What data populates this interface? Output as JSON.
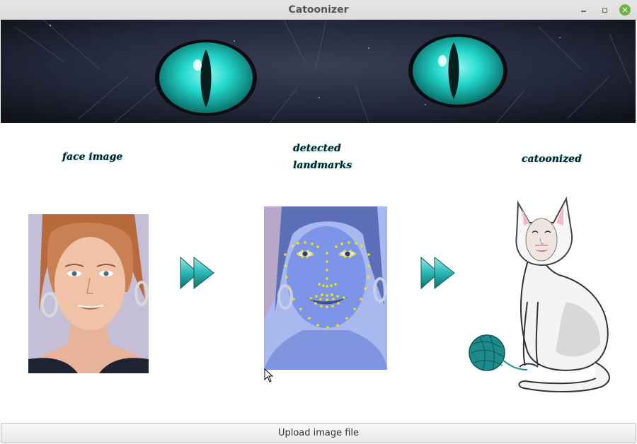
{
  "window": {
    "title": "Catoonizer",
    "controls": [
      "minimize-icon",
      "maximize-icon",
      "close-icon"
    ],
    "close_color": "#6fb24a"
  },
  "banner": {
    "image": "cat-eyes-banner",
    "eye_color": "#1fd6c8"
  },
  "columns": [
    {
      "caption": "face image",
      "image": "face-photo"
    },
    {
      "caption": "detected landmarks",
      "image": "landmarks-photo",
      "landmark_color": "#f2e600"
    },
    {
      "caption": "catoonized",
      "image": "catoonized-cat-drawing"
    }
  ],
  "arrows": {
    "icon": "fast-forward-icon",
    "color": "#2bb5b5"
  },
  "upload_button": {
    "label": "Upload image file"
  }
}
